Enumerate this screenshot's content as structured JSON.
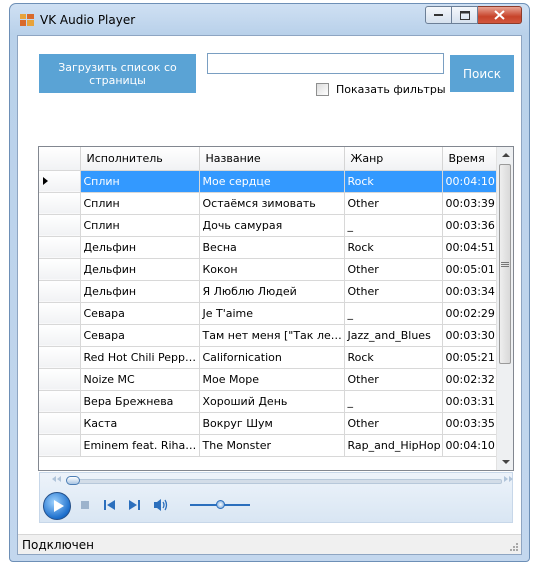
{
  "window": {
    "title": "VK Audio Player"
  },
  "toolbar": {
    "load_label": "Загрузить список со страницы",
    "search_value": "",
    "show_filters_label": "Показать фильтры",
    "show_filters_checked": false,
    "search_label": "Поиск"
  },
  "grid": {
    "columns": [
      "Исполнитель",
      "Название",
      "Жанр",
      "Время"
    ],
    "selected_row": 0,
    "rows": [
      [
        "Сплин",
        "Мое сердце",
        "Rock",
        "00:04:10"
      ],
      [
        "Сплин",
        "Остаёмся зимовать",
        "Other",
        "00:03:39"
      ],
      [
        "Сплин",
        "Дочь самурая",
        "_",
        "00:03:36"
      ],
      [
        "Дельфин",
        "Весна",
        "Rock",
        "00:04:51"
      ],
      [
        "Дельфин",
        "Кокон",
        "Other",
        "00:05:01"
      ],
      [
        "Дельфин",
        "Я Люблю Людей",
        "Other",
        "00:03:34"
      ],
      [
        "Севара",
        "Je T'aime",
        "_",
        "00:02:29"
      ],
      [
        "Севара",
        "Там нет меня [\"Так лег...",
        "Jazz_and_Blues",
        "00:03:30"
      ],
      [
        "Red Hot Chili Peppers",
        "Californication",
        "Rock",
        "00:05:21"
      ],
      [
        "Noize MC",
        "Мое Море",
        "Other",
        "00:02:32"
      ],
      [
        "Вера Брежнева",
        "Хороший День",
        "_",
        "00:03:31"
      ],
      [
        "Каста",
        "Вокруг Шум",
        "Other",
        "00:03:35"
      ],
      [
        "Eminem feat. Rihanna",
        "The Monster",
        "Rap_and_HipHop",
        "00:04:10"
      ]
    ]
  },
  "player": {
    "seek_position": 0.0,
    "volume_level": 0.5,
    "icons": [
      "play-icon",
      "stop-icon",
      "previous-icon",
      "next-icon",
      "volume-icon"
    ]
  },
  "status": {
    "text": "Подключен"
  },
  "colors": {
    "accent_button": "#5aa3d5",
    "selection": "#3399ff"
  }
}
